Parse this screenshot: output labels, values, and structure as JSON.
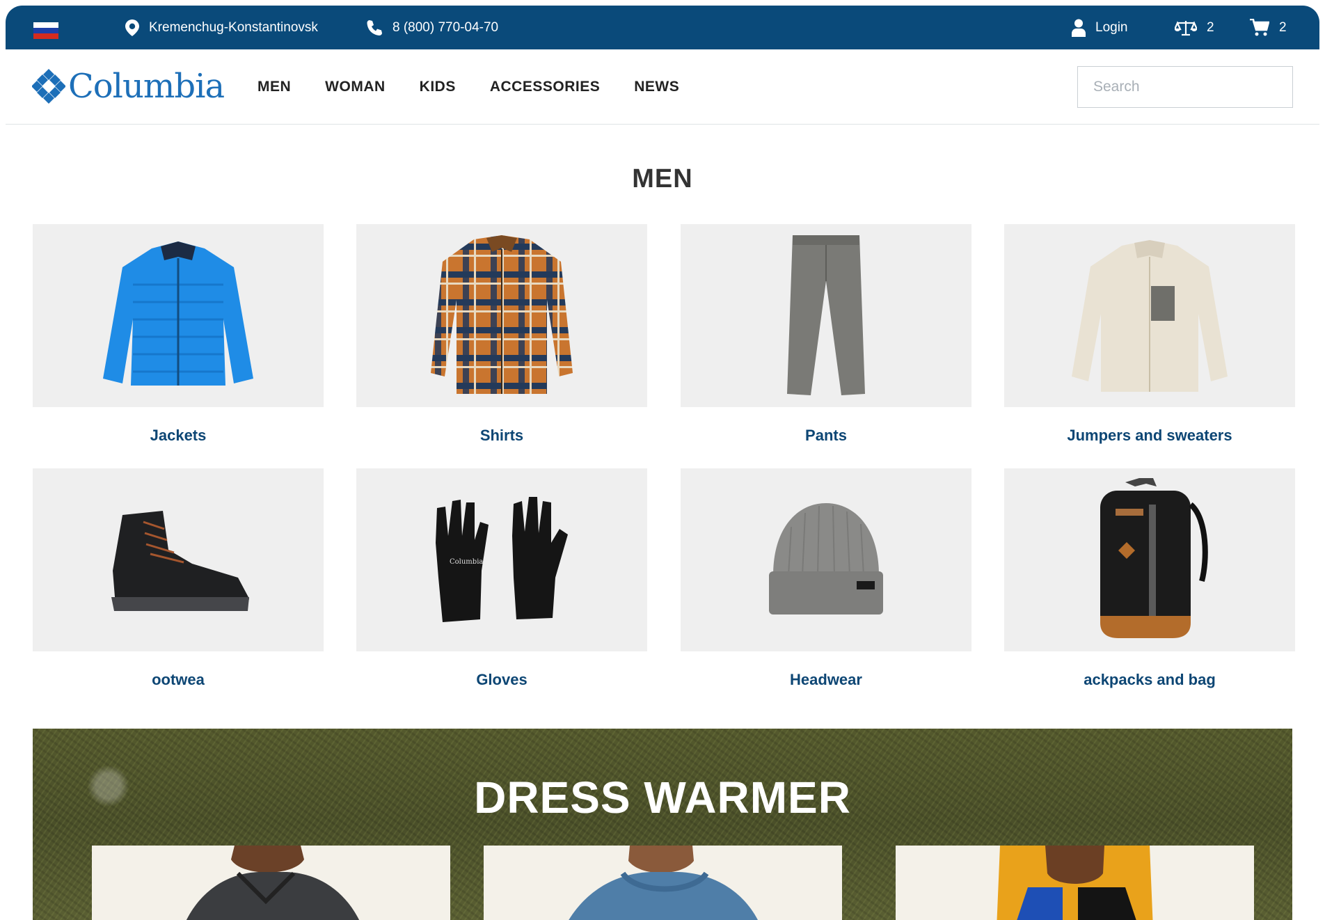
{
  "topbar": {
    "location": "Kremenchug-Konstantinovsk",
    "phone": "8 (800) 770-04-70",
    "login": "Login",
    "compare_count": "2",
    "cart_count": "2"
  },
  "header": {
    "logo_text": "Columbia",
    "nav": [
      "MEN",
      "WOMAN",
      "KIDS",
      "ACCESSORIES",
      "NEWS"
    ],
    "search_placeholder": "Search"
  },
  "main": {
    "title": "MEN",
    "categories": [
      {
        "label": "Jackets",
        "icon": "jacket-image"
      },
      {
        "label": "Shirts",
        "icon": "shirt-image"
      },
      {
        "label": "Pants",
        "icon": "pants-image"
      },
      {
        "label": "Jumpers and sweaters",
        "icon": "sweater-image"
      },
      {
        "label": "ootwea",
        "icon": "boot-image"
      },
      {
        "label": "Gloves",
        "icon": "gloves-image"
      },
      {
        "label": "Headwear",
        "icon": "beanie-image"
      },
      {
        "label": "ackpacks and bag",
        "icon": "backpack-image"
      }
    ]
  },
  "promo": {
    "title": "DRESS WARMER"
  },
  "colors": {
    "topbar": "#0a4a7a",
    "brand": "#1d6fb8",
    "category_label": "#0d4674",
    "card_bg": "#efefef"
  }
}
